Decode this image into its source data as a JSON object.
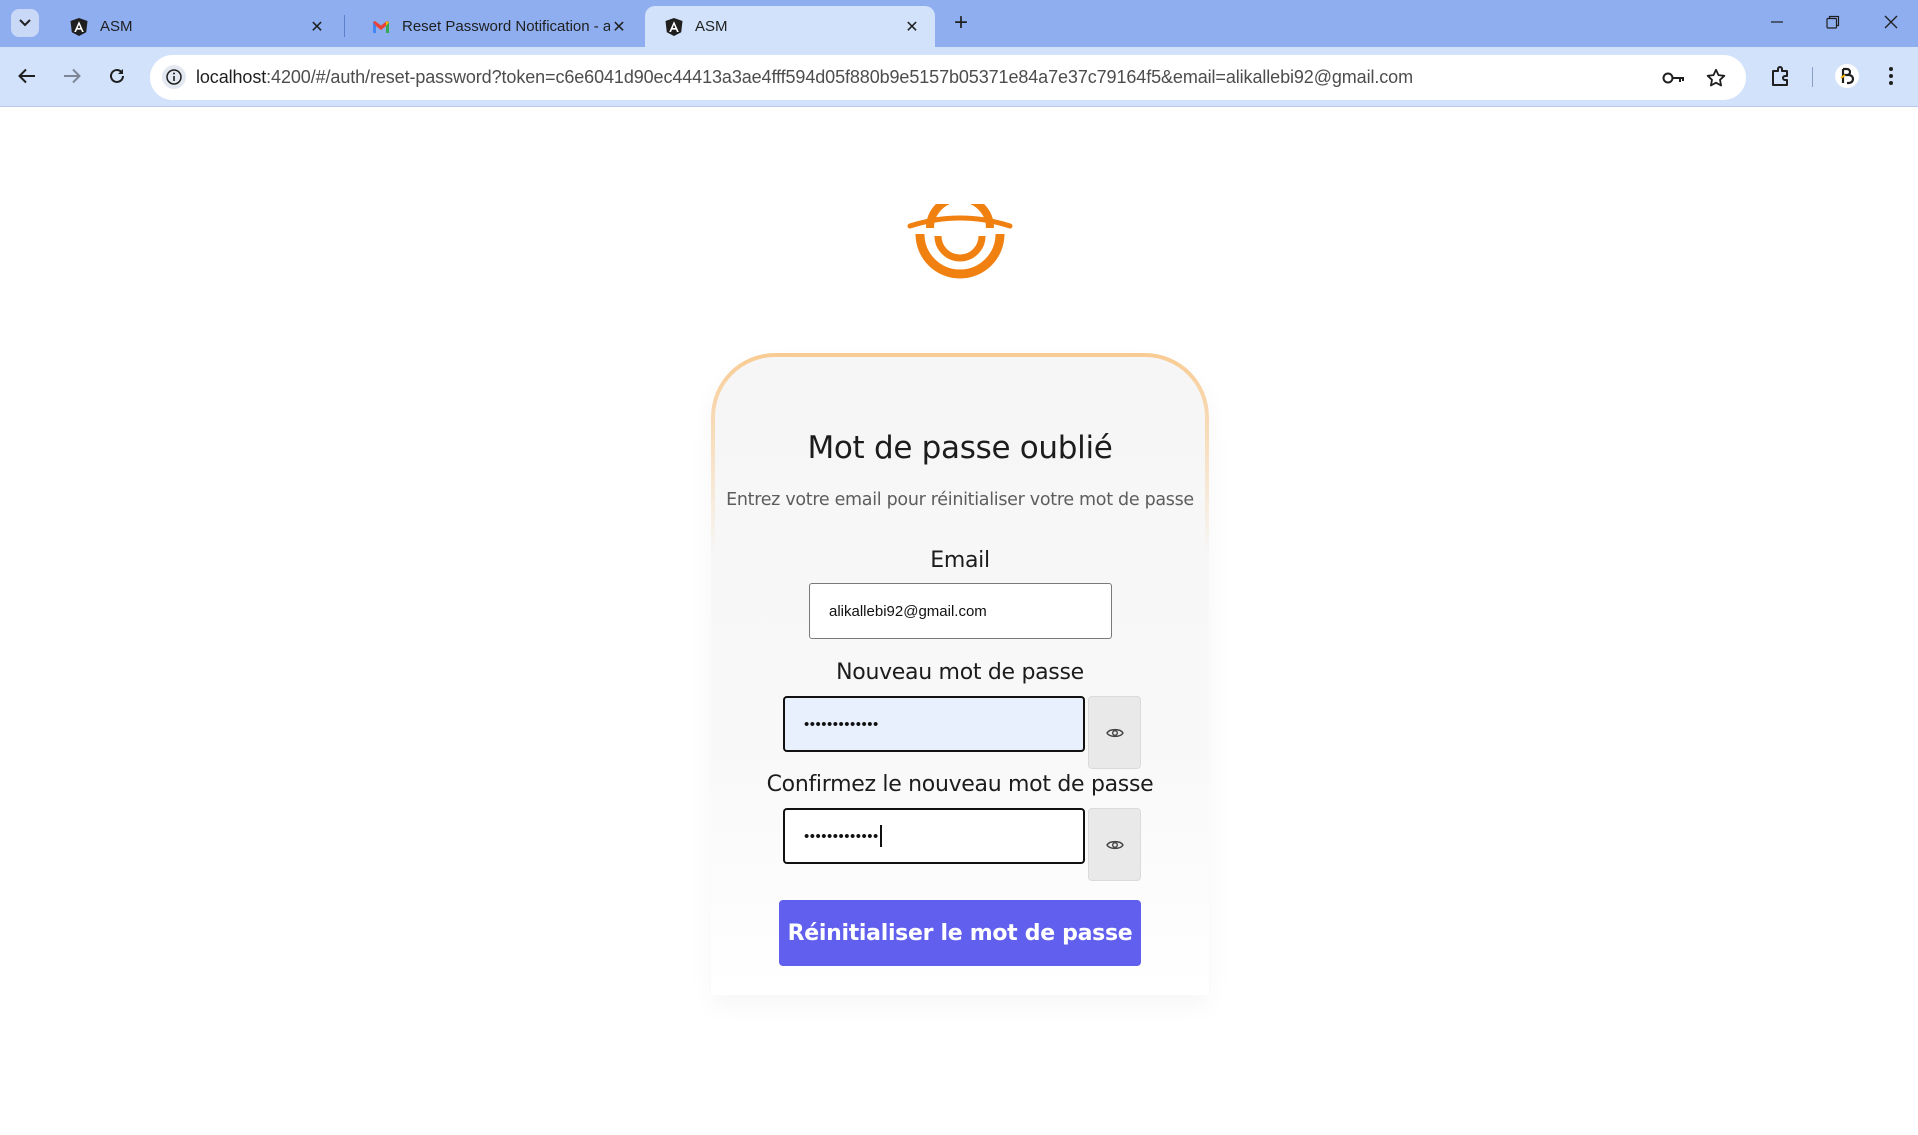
{
  "browser": {
    "tabs": [
      {
        "title": "ASM",
        "favicon": "angular-icon",
        "active": false
      },
      {
        "title": "Reset Password Notification - a",
        "favicon": "gmail-icon",
        "active": false
      },
      {
        "title": "ASM",
        "favicon": "angular-icon",
        "active": true
      }
    ],
    "new_tab_label": "+",
    "url_host": "localhost",
    "url_path": ":4200/#/auth/reset-password?token=c6e6041d90ec44413a3ae4fff594d05f880b9e5157b05371e84a7e37c79164f5&email=alikallebi92@gmail.com"
  },
  "form": {
    "title": "Mot de passe oublié",
    "subtitle": "Entrez votre email pour réinitialiser votre mot de passe",
    "email_label": "Email",
    "email_value": "alikallebi92@gmail.com",
    "new_password_label": "Nouveau mot de passe",
    "new_password_value": "•••••••••••••",
    "confirm_password_label": "Confirmez le nouveau mot de passe",
    "confirm_password_value": "•••••••••••••",
    "submit_label": "Réinitialiser le mot de passe"
  },
  "colors": {
    "tabbar": "#8eaef0",
    "toolbar": "#d3e2fb",
    "brand_orange": "#f0800f",
    "button_primary": "#6160ee",
    "autofill_bg": "#e8f0fe"
  }
}
